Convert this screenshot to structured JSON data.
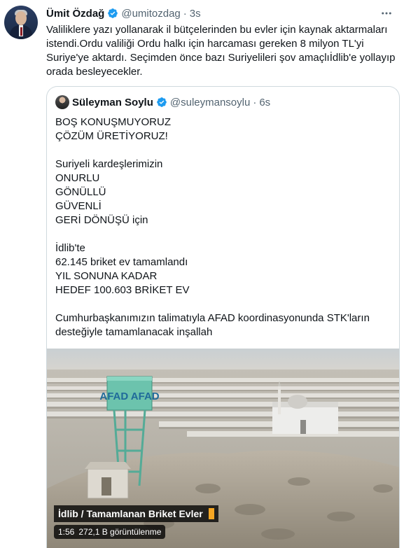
{
  "tweet": {
    "author_name": "Ümit Özdağ",
    "author_handle": "@umitozdag",
    "separator": "·",
    "time": "3s",
    "text": "Valiliklere yazı yollanarak il bütçelerinden bu evler için kaynak aktarmaları istendi.Ordu valiliği Ordu halkı için harcaması gereken 8 milyon TL'yi Suriye'ye aktardı. Seçimden önce bazı Suriyelileri şov amaçlıİdlib'e yollayıp orada besleyecekler."
  },
  "quoted_tweet": {
    "author_name": "Süleyman Soylu",
    "author_handle": "@suleymansoylu",
    "separator": "·",
    "time": "6s",
    "text": "BOŞ KONUŞMUYORUZ\nÇÖZÜM ÜRETİYORUZ!\n\nSuriyeli kardeşlerimizin\nONURLU\nGÖNÜLLÜ\nGÜVENLİ\nGERİ DÖNÜŞÜ için\n\nİdlib'te\n62.145 briket ev tamamlandı\nYIL SONUNA KADAR\nHEDEF 100.603 BRİKET EV\n\nCumhurbaşkanımızın talimatıyla AFAD koordinasyonunda STK'ların desteğiyle tamamlanacak inşallah"
  },
  "video": {
    "caption": "İdlib / Tamamlanan Briket Evler",
    "duration": "1:56",
    "views": "272,1 B görüntülenme",
    "tower_text": "AFAD AFAD"
  },
  "icons": {
    "verified": "verified-badge-icon",
    "more": "more-options-icon"
  },
  "colors": {
    "verified_blue": "#1d9bf0",
    "secondary_text": "#536471",
    "tower_green": "#5fb3a1"
  }
}
